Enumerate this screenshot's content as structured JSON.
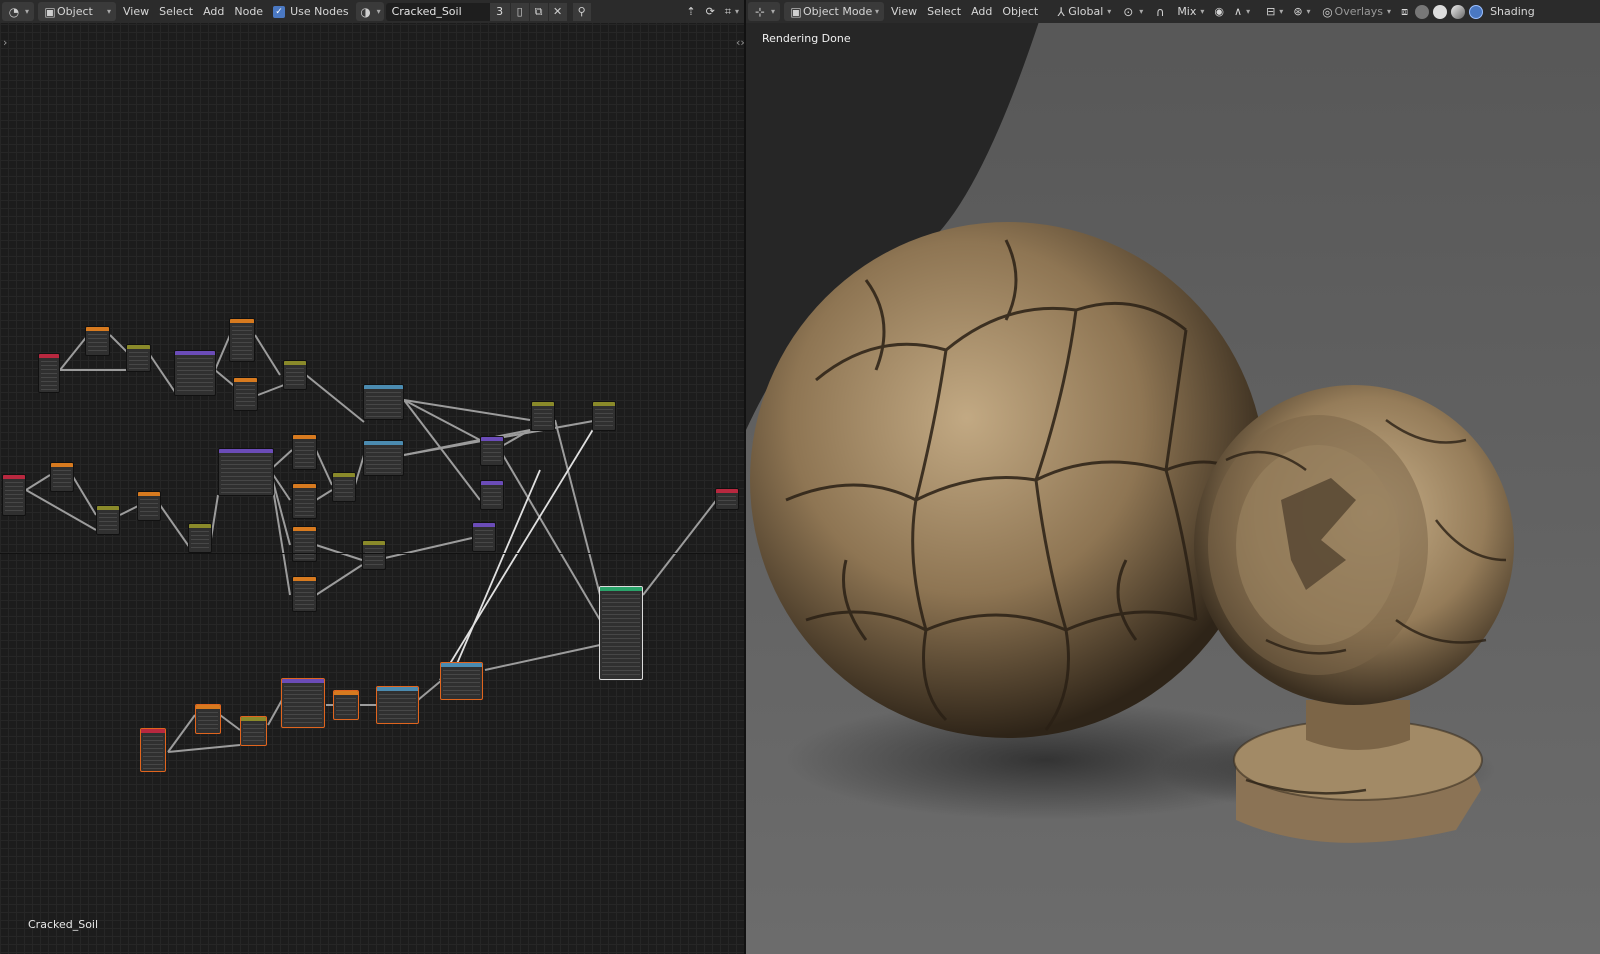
{
  "node_editor": {
    "header": {
      "editor_type_icon": "shader-editor-icon",
      "object_label": "Object",
      "menu": [
        "View",
        "Select",
        "Add",
        "Node"
      ],
      "use_nodes_label": "Use Nodes",
      "use_nodes_checked": true,
      "material_name": "Cracked_Soil",
      "user_count": "3"
    },
    "footer_material_name": "Cracked_Soil"
  },
  "viewport": {
    "header": {
      "mode_label": "Object Mode",
      "menu": [
        "View",
        "Select",
        "Add",
        "Object"
      ],
      "transform_orientation": "Global",
      "snap_mode": "Mix",
      "overlays_label": "Overlays",
      "shading_label": "Shading"
    },
    "status": "Rendering Done"
  },
  "colors": {
    "node_input": "#b8283f",
    "node_texture": "#d77a1f",
    "node_converter": "#4b8bb0",
    "node_vector": "#6b4cb8",
    "node_shader": "#2aa36a",
    "node_group": "#8a8a2a",
    "selection": "#e0651e",
    "soil": "#8b7355"
  }
}
